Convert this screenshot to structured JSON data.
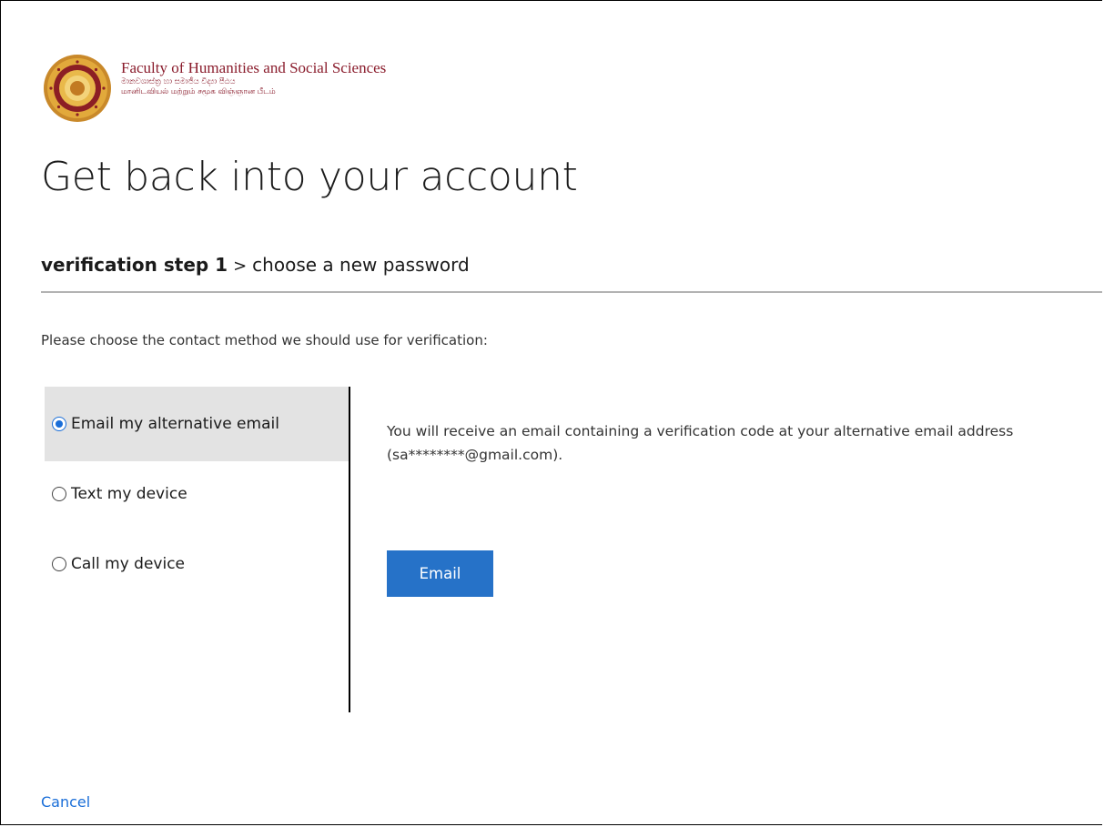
{
  "brand": {
    "title": "Faculty of Humanities and Social Sciences",
    "subtitle_sinhala": "මානවශාස්ත්‍ර හා සමාජීය විද්‍යා පීඨය",
    "subtitle_tamil": "மானிடவியல் மற்றும் சமூக விஞ்ஞான பீடம்",
    "logo_icon": "university-seal-icon"
  },
  "page": {
    "title": "Get back into your account"
  },
  "breadcrumb": {
    "current": "verification step 1",
    "separator": ">",
    "next": "choose a new password"
  },
  "instruction": "Please choose the contact method we should use for verification:",
  "options": [
    {
      "label": "Email my alternative email",
      "selected": true
    },
    {
      "label": "Text my device",
      "selected": false
    },
    {
      "label": "Call my device",
      "selected": false
    }
  ],
  "detail": {
    "description": "You will receive an email containing a verification code at your alternative email address (sa********@gmail.com).",
    "button_label": "Email"
  },
  "footer": {
    "cancel_label": "Cancel"
  },
  "colors": {
    "accent": "#2672c8",
    "brand": "#8a1c2c",
    "link": "#1a6ed8",
    "selected_bg": "#e3e3e3"
  }
}
